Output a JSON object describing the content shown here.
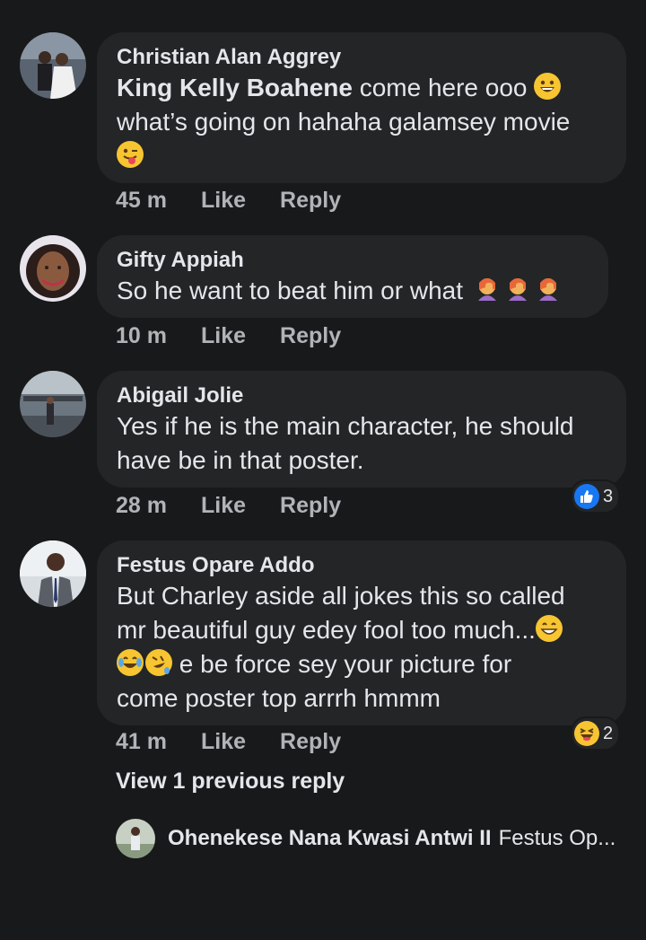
{
  "comments": [
    {
      "author": "Christian Alan Aggrey",
      "mention": "King Kelly Boahene",
      "text_line1": " come here ooo",
      "text_line2": "what’s going on hahaha galamsey movie",
      "time": "45 m",
      "like": "Like",
      "reply": "Reply"
    },
    {
      "author": "Gifty Appiah",
      "text": "So he want to beat him or what",
      "time": "10 m",
      "like": "Like",
      "reply": "Reply"
    },
    {
      "author": "Abigail Jolie",
      "text_line1": "Yes if he is the main character, he should",
      "text_line2": "have be in that poster.",
      "time": "28 m",
      "like": "Like",
      "reply": "Reply",
      "reaction_count": "3"
    },
    {
      "author": "Festus Opare Addo",
      "text_line1": "But Charley aside all jokes this so called",
      "text_line2": "mr beautiful guy edey fool too much...",
      "text_line3": " e be force sey your picture for",
      "text_line4": "come poster top arrrh hmmm",
      "time": "41 m",
      "like": "Like",
      "reply": "Reply",
      "reaction_count": "2"
    }
  ],
  "view_previous": "View 1 previous reply",
  "reply_preview": {
    "author": "Ohenekese Nana Kwasi Antwi II",
    "snippet": "Festus Op..."
  },
  "colors": {
    "background": "#18191a",
    "bubble": "#242526",
    "text": "#e4e6eb",
    "meta": "#b0b3b8",
    "like_blue": "#1877f2",
    "emoji_yellow": "#f7c531"
  }
}
